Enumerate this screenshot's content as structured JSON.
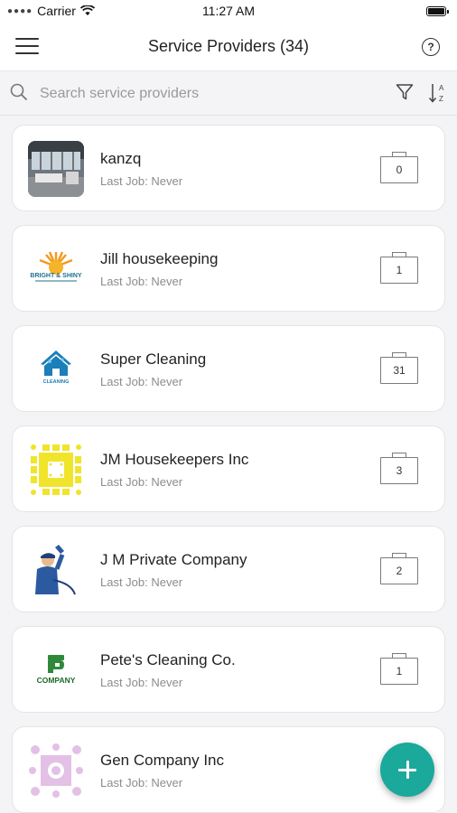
{
  "status_bar": {
    "carrier": "Carrier",
    "time": "11:27 AM"
  },
  "header": {
    "title": "Service Providers (34)"
  },
  "search": {
    "placeholder": "Search service providers"
  },
  "providers": [
    {
      "name": "kanzq",
      "last_job": "Last Job: Never",
      "job_count": "0",
      "logo": "room-photo"
    },
    {
      "name": "Jill housekeeping",
      "last_job": "Last Job: Never",
      "job_count": "1",
      "logo": "bright-shiny-logo",
      "logo_text": "BRIGHT & SHINY"
    },
    {
      "name": "Super Cleaning",
      "last_job": "Last Job: Never",
      "job_count": "31",
      "logo": "cleaning-house-logo",
      "logo_text": "CLEANING"
    },
    {
      "name": "JM Housekeepers Inc",
      "last_job": "Last Job: Never",
      "job_count": "3",
      "logo": "yellow-pattern-logo"
    },
    {
      "name": "J M Private Company",
      "last_job": "Last Job: Never",
      "job_count": "2",
      "logo": "window-cleaner-logo"
    },
    {
      "name": "Pete's Cleaning Co.",
      "last_job": "Last Job: Never",
      "job_count": "1",
      "logo": "company-logo",
      "logo_text": "COMPANY"
    },
    {
      "name": "Gen Company Inc",
      "last_job": "Last Job: Never",
      "job_count": "",
      "logo": "pink-pattern-logo"
    }
  ],
  "colors": {
    "accent": "#1aa99a",
    "background": "#f4f4f6"
  }
}
